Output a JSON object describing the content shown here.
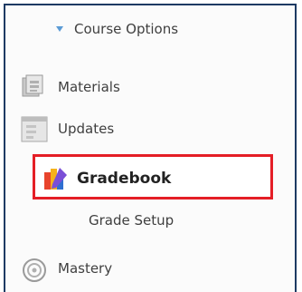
{
  "nav": {
    "course_options": "Course Options",
    "items": [
      {
        "label": "Materials",
        "icon": "materials-icon"
      },
      {
        "label": "Updates",
        "icon": "updates-icon"
      },
      {
        "label": "Gradebook",
        "icon": "gradebook-icon",
        "highlighted": true
      },
      {
        "label": "Grade Setup"
      },
      {
        "label": "Mastery",
        "icon": "mastery-icon"
      }
    ]
  },
  "colors": {
    "frame_border": "#1d3a63",
    "highlight_border": "#e41e26",
    "chevron": "#5b9bd5",
    "text": "#3f3f3f"
  }
}
